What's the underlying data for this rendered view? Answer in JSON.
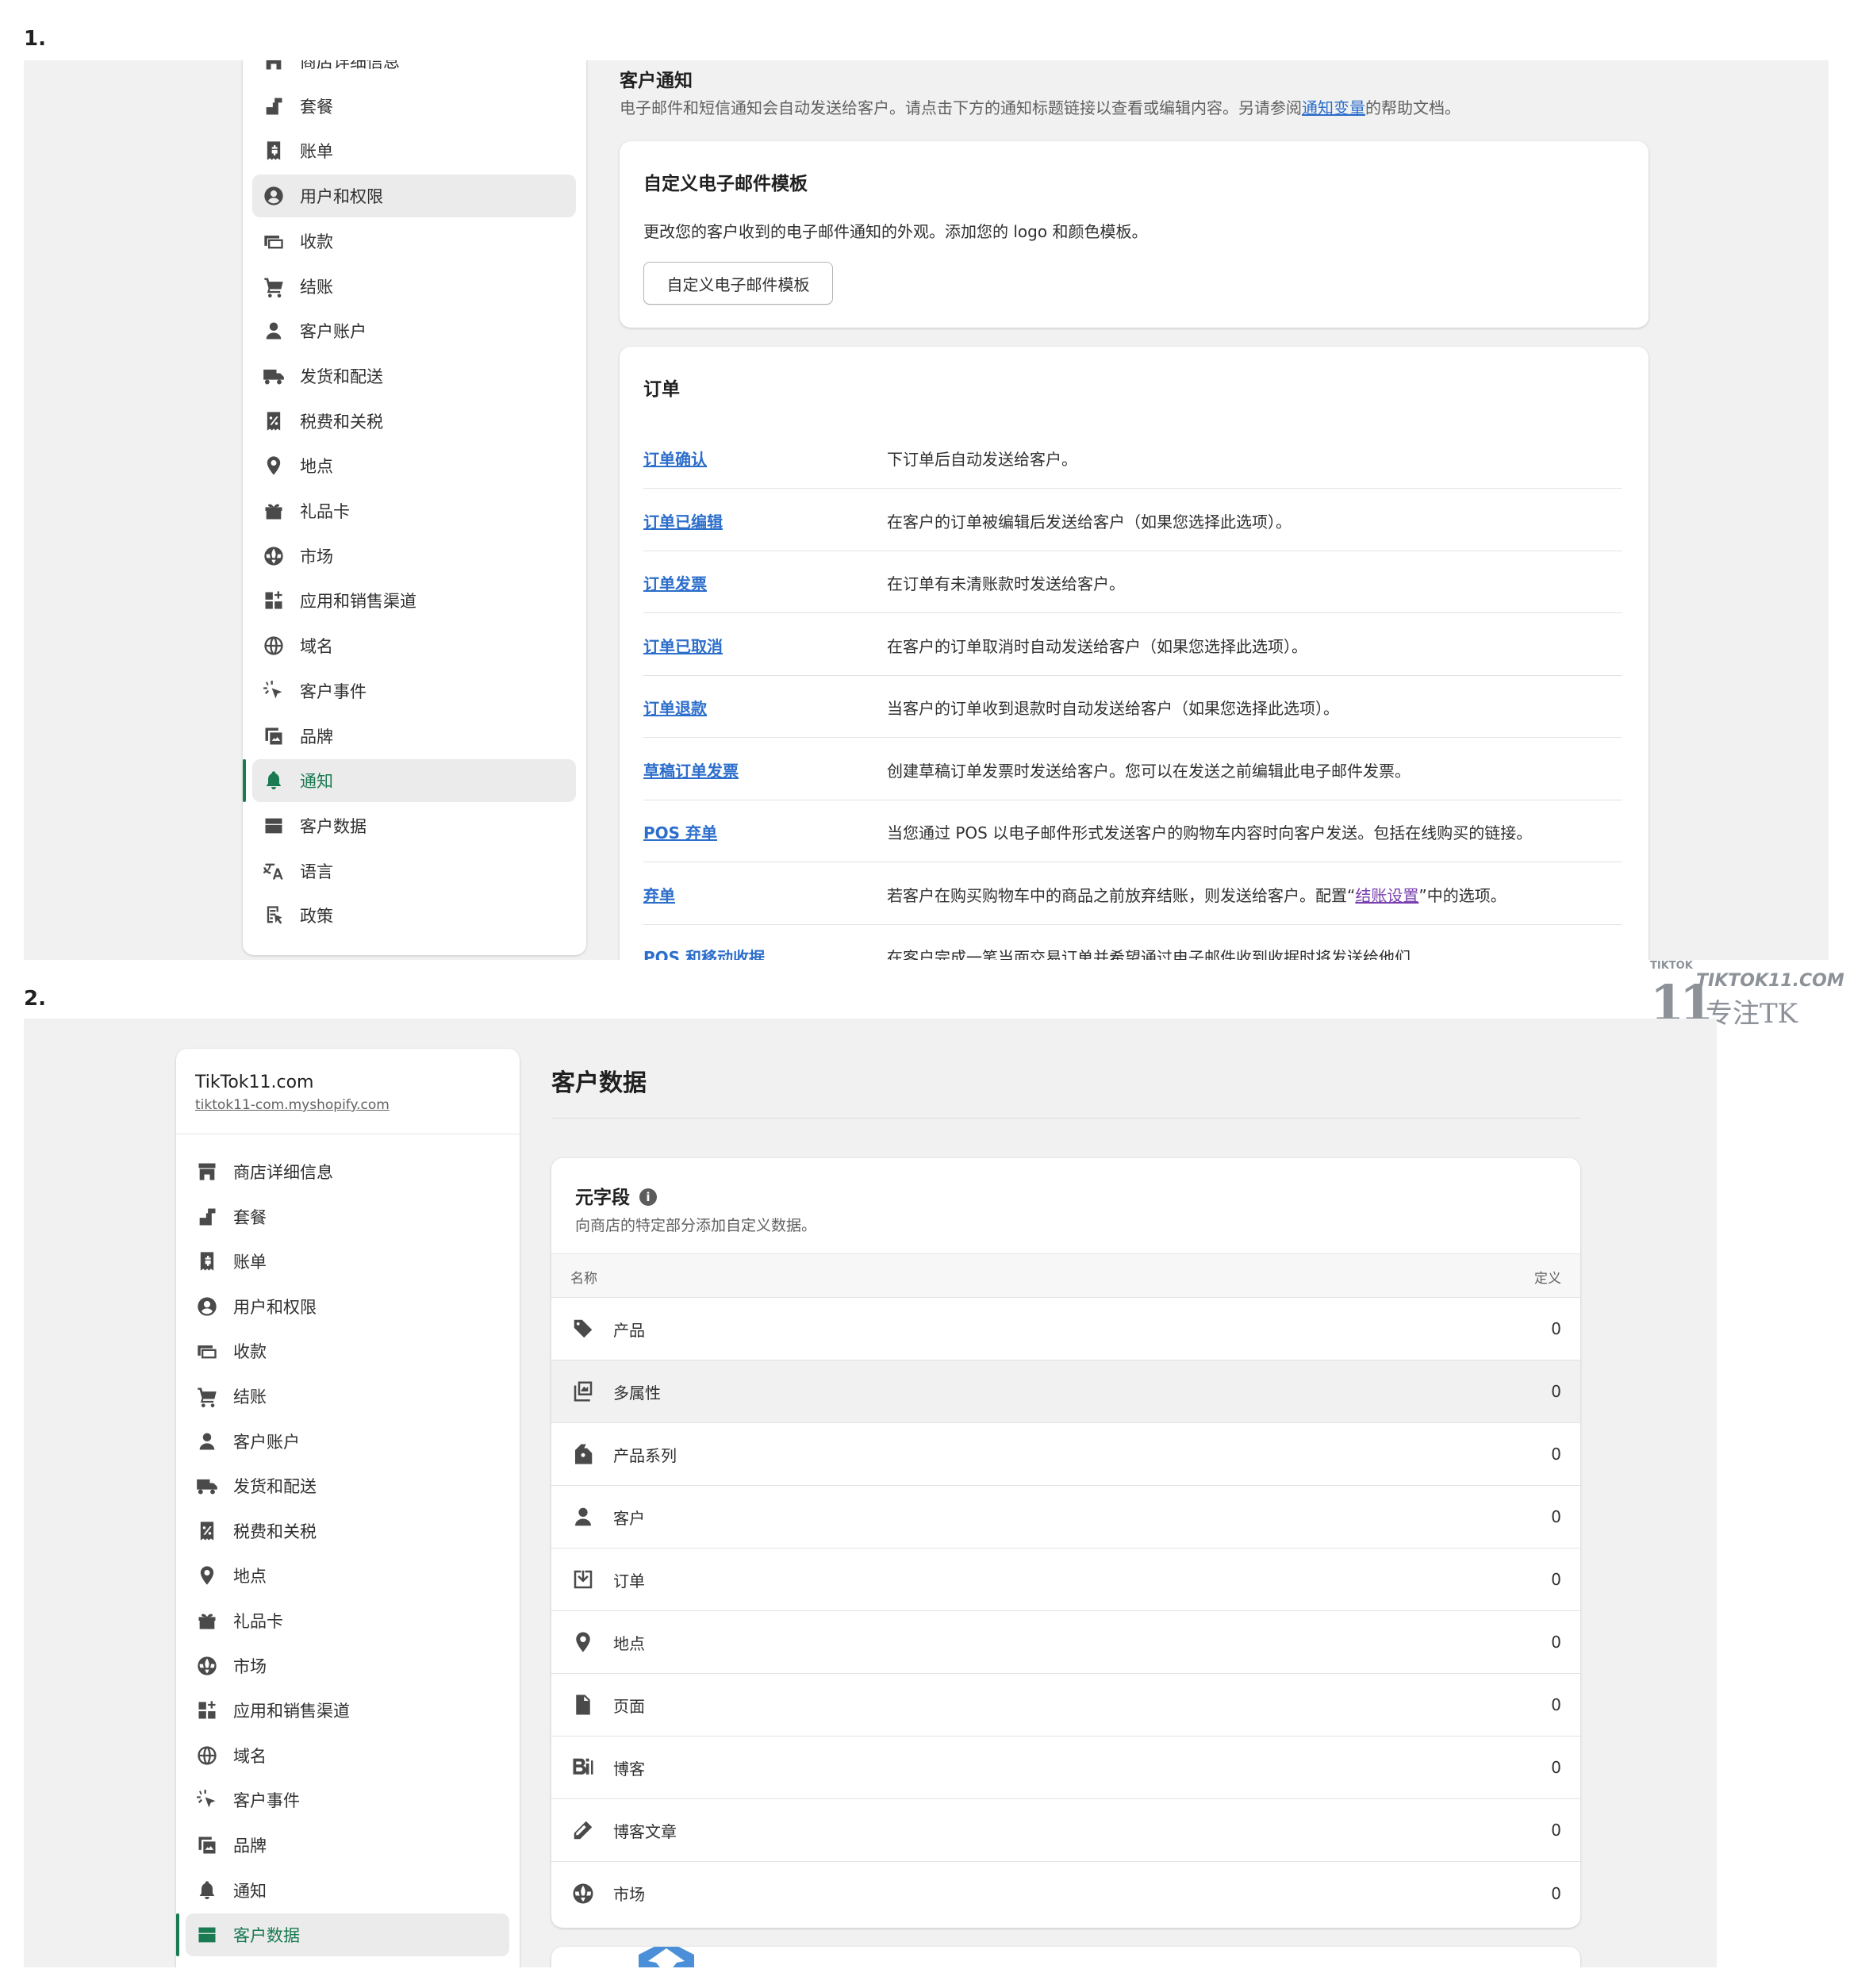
{
  "steps": {
    "first": "1.",
    "second": "2."
  },
  "sidebar": {
    "store_name": "TikTok11.com",
    "store_url": "tiktok11-com.myshopify.com",
    "items": [
      {
        "label": "商店详细信息",
        "icon": "store-icon"
      },
      {
        "label": "套餐",
        "icon": "plan-icon"
      },
      {
        "label": "账单",
        "icon": "billing-icon"
      },
      {
        "label": "用户和权限",
        "icon": "user-circle-icon"
      },
      {
        "label": "收款",
        "icon": "payments-icon"
      },
      {
        "label": "结账",
        "icon": "cart-icon"
      },
      {
        "label": "客户账户",
        "icon": "person-icon"
      },
      {
        "label": "发货和配送",
        "icon": "truck-icon"
      },
      {
        "label": "税费和关税",
        "icon": "tax-icon"
      },
      {
        "label": "地点",
        "icon": "location-icon"
      },
      {
        "label": "礼品卡",
        "icon": "gift-icon"
      },
      {
        "label": "市场",
        "icon": "globe-market-icon"
      },
      {
        "label": "应用和销售渠道",
        "icon": "apps-icon"
      },
      {
        "label": "域名",
        "icon": "globe-icon"
      },
      {
        "label": "客户事件",
        "icon": "cursor-click-icon"
      },
      {
        "label": "品牌",
        "icon": "brand-icon"
      },
      {
        "label": "通知",
        "icon": "bell-icon"
      },
      {
        "label": "客户数据",
        "icon": "data-icon"
      },
      {
        "label": "语言",
        "icon": "language-icon"
      },
      {
        "label": "政策",
        "icon": "policy-icon"
      }
    ]
  },
  "notifications": {
    "title": "客户通知",
    "desc_before": "电子邮件和短信通知会自动发送给客户。请点击下方的通知标题链接以查看或编辑内容。另请参阅",
    "desc_link": "通知变量",
    "desc_after": "的帮助文档。",
    "template_card": {
      "title": "自定义电子邮件模板",
      "text": "更改您的客户收到的电子邮件通知的外观。添加您的 logo 和颜色模板。",
      "button": "自定义电子邮件模板"
    },
    "orders_card": {
      "title": "订单",
      "rows": [
        {
          "name": "订单确认",
          "desc": "下订单后自动发送给客户。"
        },
        {
          "name": "订单已编辑",
          "desc": "在客户的订单被编辑后发送给客户（如果您选择此选项）。"
        },
        {
          "name": "订单发票",
          "desc": "在订单有未清账款时发送给客户。"
        },
        {
          "name": "订单已取消",
          "desc": "在客户的订单取消时自动发送给客户（如果您选择此选项）。"
        },
        {
          "name": "订单退款",
          "desc": "当客户的订单收到退款时自动发送给客户（如果您选择此选项）。"
        },
        {
          "name": "草稿订单发票",
          "desc": "创建草稿订单发票时发送给客户。您可以在发送之前编辑此电子邮件发票。"
        },
        {
          "name": "POS 弃单",
          "desc": "当您通过 POS 以电子邮件形式发送客户的购物车内容时向客户发送。包括在线购买的链接。"
        },
        {
          "name": "弃单",
          "desc_before": "若客户在购买购物车中的商品之前放弃结账，则发送给客户。配置“",
          "desc_link": "结账设置",
          "desc_after": "”中的选项。"
        },
        {
          "name": "POS 和移动收据",
          "desc": "在客户完成一笔当面交易订单并希望通过电子邮件收到收据时将发送给他们"
        }
      ]
    }
  },
  "customer_data": {
    "title": "客户数据",
    "metafields": {
      "title": "元字段",
      "info": "i",
      "desc": "向商店的特定部分添加自定义数据。",
      "col_name": "名称",
      "col_def": "定义",
      "rows": [
        {
          "name": "产品",
          "count": "0",
          "icon": "tag-icon"
        },
        {
          "name": "多属性",
          "count": "0",
          "icon": "variants-icon"
        },
        {
          "name": "产品系列",
          "count": "0",
          "icon": "collection-icon"
        },
        {
          "name": "客户",
          "count": "0",
          "icon": "customer-icon"
        },
        {
          "name": "订单",
          "count": "0",
          "icon": "order-inbox-icon"
        },
        {
          "name": "地点",
          "count": "0",
          "icon": "location-icon"
        },
        {
          "name": "页面",
          "count": "0",
          "icon": "page-icon"
        },
        {
          "name": "博客",
          "count": "0",
          "icon": "blog-icon"
        },
        {
          "name": "博客文章",
          "count": "0",
          "icon": "pencil-icon"
        },
        {
          "name": "市场",
          "count": "0",
          "icon": "globe-market-icon"
        }
      ]
    }
  },
  "watermark": {
    "small": "TIKTOK",
    "num": "11",
    "brand": "TIKTOK11.COM",
    "cn": "专注TK"
  },
  "colors": {
    "active_green": "#1a7a52",
    "link_blue": "#2c6ecb",
    "visited_purple": "#7a3fae"
  }
}
